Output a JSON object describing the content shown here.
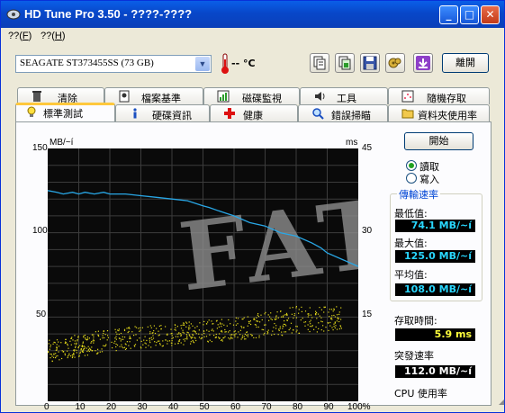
{
  "window": {
    "title": "HD Tune Pro 3.50 - ????-????",
    "buttons": {
      "minimize": "_",
      "maximize": "□",
      "close": "✕"
    }
  },
  "menu": [
    {
      "label": "??(",
      "key": "F",
      "suffix": ")"
    },
    {
      "label": "??(",
      "key": "H",
      "suffix": ")"
    }
  ],
  "toolbar": {
    "drive": "SEAGATE ST373455SS (73 GB)",
    "temperature": "-- °C",
    "exit_label": "離開",
    "icons": [
      "copy-text-icon",
      "copy-screen-icon",
      "save-icon",
      "options-icon",
      "download-icon"
    ]
  },
  "tabs_top": [
    "清除",
    "檔案基準",
    "磁碟監視",
    "工具",
    "隨機存取"
  ],
  "tabs_bottom": [
    "標準測試",
    "硬碟資訊",
    "健康",
    "錯誤掃瞄",
    "資料夾使用率"
  ],
  "active_tab": "標準測試",
  "benchmark": {
    "start_button": "開始",
    "mode_read": "讀取",
    "mode_write": "寫入",
    "selected_mode": "讀取",
    "group_title": "傳輸速率",
    "min_label": "最低值:",
    "min_value": "74.1 MB/~í",
    "max_label": "最大值:",
    "max_value": "125.0 MB/~í",
    "avg_label": "平均值:",
    "avg_value": "108.0 MB/~í",
    "access_label": "存取時間:",
    "access_value": "5.9 ms",
    "burst_label": "突發速率",
    "burst_value": "112.0 MB/~í",
    "cpu_label": "CPU 使用率"
  },
  "chart_data": {
    "type": "line",
    "left_axis_unit": "MB/~í",
    "right_axis_unit": "ms",
    "left_ticks": [
      "150",
      "100",
      "50"
    ],
    "right_ticks": [
      "45",
      "30",
      "15"
    ],
    "x_ticks": [
      "0",
      "10",
      "20",
      "30",
      "40",
      "50",
      "60",
      "70",
      "80",
      "90",
      "100%"
    ],
    "ylim_left": [
      0,
      150
    ],
    "ylim_right": [
      0,
      45
    ],
    "xlim": [
      0,
      100
    ],
    "watermark": "FAT",
    "series": [
      {
        "name": "transfer",
        "color": "#29a7e6",
        "x": [
          0,
          3,
          5,
          8,
          10,
          12,
          15,
          18,
          20,
          25,
          30,
          35,
          40,
          45,
          50,
          52,
          55,
          60,
          65,
          70,
          75,
          80,
          85,
          88,
          90,
          95,
          100
        ],
        "y": [
          125,
          124,
          123,
          124,
          123,
          124,
          123,
          124,
          123,
          123,
          122,
          121,
          120,
          119,
          116,
          115,
          113,
          110,
          106,
          104,
          100,
          98,
          94,
          91,
          88,
          84,
          80
        ]
      },
      {
        "name": "access",
        "color": "#e2d81a",
        "band": [
          [
            0,
            7,
            11
          ],
          [
            20,
            9,
            13
          ],
          [
            40,
            10,
            14
          ],
          [
            60,
            11,
            15
          ],
          [
            80,
            12,
            17
          ],
          [
            95,
            13,
            17
          ]
        ]
      }
    ]
  }
}
